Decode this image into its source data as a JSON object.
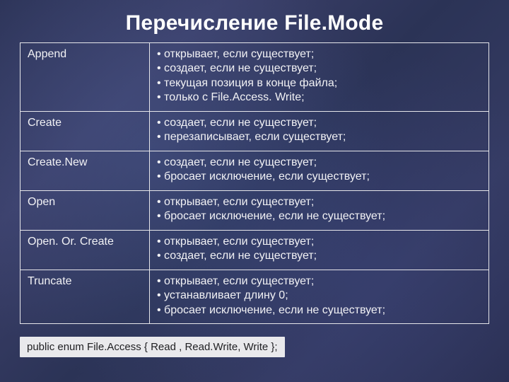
{
  "title": "Перечисление File.Mode",
  "rows": [
    {
      "name": "Append",
      "points": [
        "• открывает, если существует;",
        "• создает, если не существует;",
        "• текущая позиция в конце файла;",
        "• только с File.Access. Write;"
      ]
    },
    {
      "name": "Create",
      "points": [
        "• создает, если не существует;",
        "• перезаписывает, если существует;"
      ]
    },
    {
      "name": "Create.New",
      "points": [
        "• создает, если не существует;",
        "• бросает исключение, если существует;"
      ]
    },
    {
      "name": "Open",
      "points": [
        "• открывает, если существует;",
        "• бросает исключение, если не существует;"
      ]
    },
    {
      "name": "Open. Or. Create",
      "points": [
        "• открывает, если существует;",
        "• создает, если не существует;"
      ]
    },
    {
      "name": "Truncate",
      "points": [
        "• открывает, если существует;",
        "• устанавливает длину 0;",
        "• бросает исключение, если не существует;"
      ]
    }
  ],
  "footer_code": "public enum File.Access { Read , Read.Write, Write };"
}
